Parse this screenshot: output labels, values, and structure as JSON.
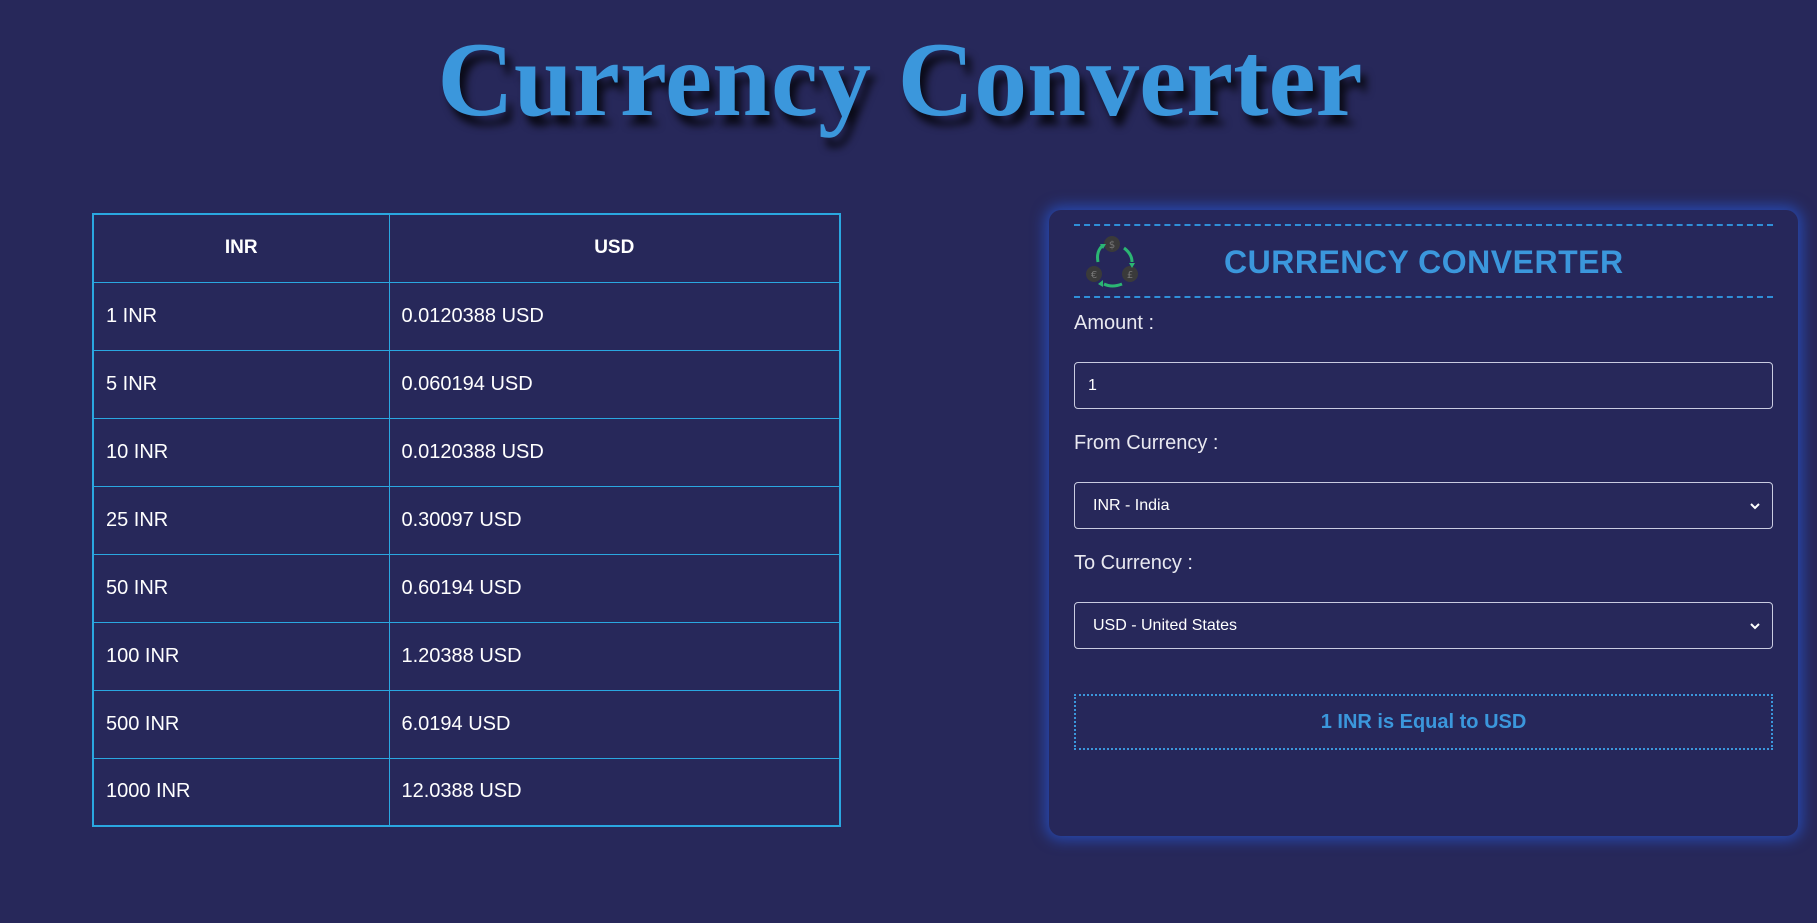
{
  "page": {
    "title": "Currency Converter"
  },
  "table": {
    "headers": [
      "INR",
      "USD"
    ],
    "rows": [
      [
        "1 INR",
        "0.0120388 USD"
      ],
      [
        "5 INR",
        "0.060194 USD"
      ],
      [
        "10 INR",
        "0.0120388 USD"
      ],
      [
        "25 INR",
        "0.30097 USD"
      ],
      [
        "50 INR",
        "0.60194 USD"
      ],
      [
        "100 INR",
        "1.20388 USD"
      ],
      [
        "500 INR",
        "6.0194 USD"
      ],
      [
        "1000 INR",
        "12.0388 USD"
      ]
    ]
  },
  "converter": {
    "title": "CURRENCY CONVERTER",
    "logo_icon": "currency-exchange-icon",
    "amount_label": "Amount :",
    "amount_value": "1",
    "from_label": "From Currency :",
    "from_value": "INR - India",
    "to_label": "To Currency :",
    "to_value": "USD - United States",
    "result": "1 INR is Equal to USD"
  },
  "colors": {
    "background": "#27285a",
    "accent": "#3b97dc",
    "table_border": "#2aa7e0",
    "icon_green": "#2bb673",
    "icon_coin": "#3a3a3a"
  }
}
